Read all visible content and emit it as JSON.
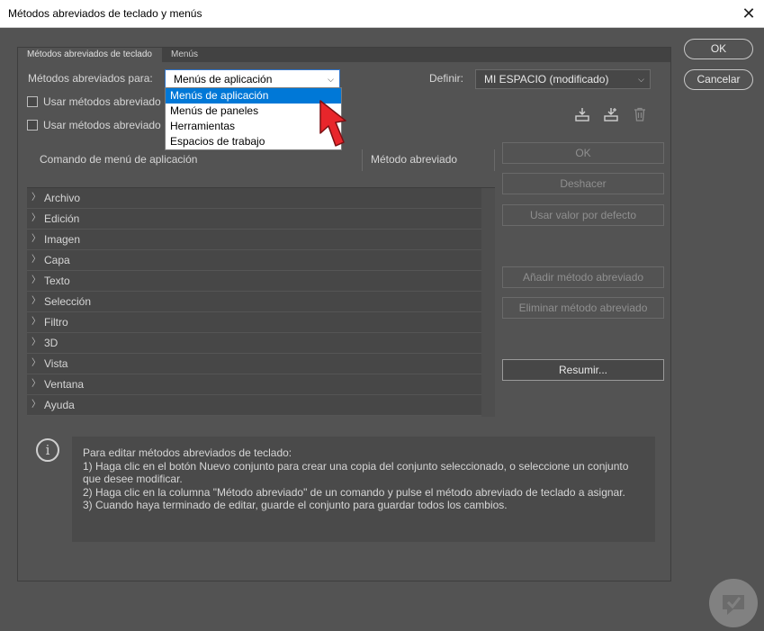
{
  "window": {
    "title": "Métodos abreviados de teclado y menús"
  },
  "tabs": [
    {
      "label": "Métodos abreviados de teclado"
    },
    {
      "label": "Menús"
    }
  ],
  "shortcuts_for": {
    "label": "Métodos abreviados para:",
    "selected": "Menús de aplicación",
    "options": [
      "Menús de aplicación",
      "Menús de paneles",
      "Herramientas",
      "Espacios de trabajo"
    ]
  },
  "define": {
    "label": "Definir:",
    "selected": "MI ESPACIO (modificado)"
  },
  "checkboxes": [
    {
      "label": "Usar métodos abreviado"
    },
    {
      "label": "Usar métodos abreviado"
    }
  ],
  "columns": {
    "command": "Comando de menú de aplicación",
    "shortcut": "Método abreviado"
  },
  "menu_items": [
    "Archivo",
    "Edición",
    "Imagen",
    "Capa",
    "Texto",
    "Selección",
    "Filtro",
    "3D",
    "Vista",
    "Ventana",
    "Ayuda"
  ],
  "side_buttons": {
    "ok": "OK",
    "undo": "Deshacer",
    "default": "Usar valor por defecto",
    "add": "Añadir método abreviado",
    "remove": "Eliminar método abreviado",
    "summary": "Resumir..."
  },
  "dialog_buttons": {
    "ok": "OK",
    "cancel": "Cancelar"
  },
  "info": {
    "line1": "Para editar métodos abreviados de teclado:",
    "line2": "1) Haga clic en el botón Nuevo conjunto para crear una copia del conjunto seleccionado, o seleccione un conjunto que desee modificar.",
    "line3": "2) Haga clic en la columna \"Método abreviado\" de un comando y pulse el método abreviado de teclado a asignar.",
    "line4": "3) Cuando haya terminado de editar, guarde el conjunto para guardar todos los cambios."
  },
  "colors": {
    "accent": "#0078d7",
    "cursor": "#e8262b"
  }
}
